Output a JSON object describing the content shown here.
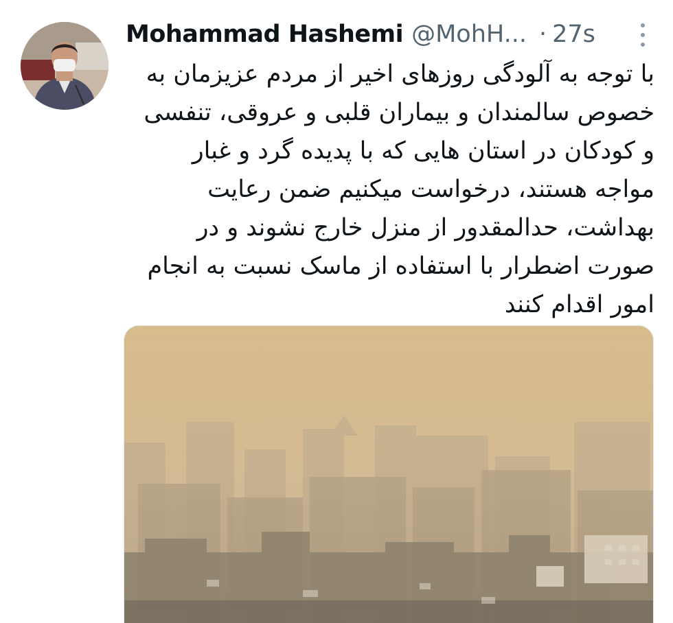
{
  "tweet": {
    "author": {
      "display_name": "Mohammad Hashemi",
      "handle": "@MohH...",
      "avatar_icon": "profile-photo"
    },
    "separator": "·",
    "timestamp": "27s",
    "more_icon": "vertical-ellipsis-icon",
    "text_lines": [
      "با توجه به آلودگی روزهای اخیر از مردم عزیزمان به",
      "خصوص سالمندان و بیماران قلبی و عروقی، تنفسی",
      "و کودکان در استان هایی که با پدیده گرد و غبار",
      "مواجه هستند، درخواست میکنیم ضمن رعایت",
      "بهداشت، حدالمقدور از منزل خارج نشوند و در",
      "صورت اضطرار با استفاده از ماسک نسبت به انجام",
      "امور اقدام کنند"
    ],
    "media": {
      "type": "photo",
      "subject": "hazy-city-skyline"
    }
  }
}
